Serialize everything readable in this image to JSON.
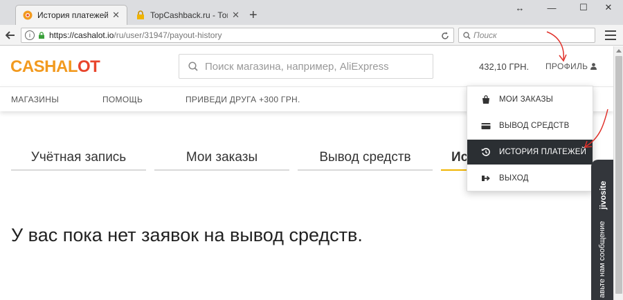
{
  "browser": {
    "tabs": [
      {
        "title": "История платежей | Cash...",
        "active": true
      },
      {
        "title": "TopCashback.ru - Топ лу...",
        "active": false
      }
    ],
    "new_tab_label": "+",
    "window_controls": {
      "resize": "↔",
      "minimize": "—",
      "maximize": "☐",
      "close": "✕"
    },
    "url": {
      "host": "https://cashalot.io",
      "path": "/ru/user/31947/payout-history"
    },
    "search_placeholder": "Поиск",
    "tab_close": "✕"
  },
  "site": {
    "logo": {
      "part1": "CASHAL",
      "part2": "OT"
    },
    "search_placeholder": "Поиск магазина, например, AliExpress",
    "balance": "432,10 ГРН.",
    "profile_label": "ПРОФИЛЬ",
    "menu": [
      "МАГАЗИНЫ",
      "ПОМОЩЬ",
      "ПРИВЕДИ ДРУГА +300 ГРН."
    ],
    "page_tabs": [
      "Учётная запись",
      "Мои заказы",
      "Вывод средств",
      "Ис"
    ],
    "empty_message": "У вас пока нет заявок на вывод средств.",
    "dropdown": [
      {
        "label": "МОИ ЗАКАЗЫ",
        "icon": "bag-icon",
        "active": false
      },
      {
        "label": "ВЫВОД СРЕДСТВ",
        "icon": "card-icon",
        "active": false
      },
      {
        "label": "ИСТОРИЯ ПЛАТЕЖЕЙ",
        "icon": "history-icon",
        "active": true
      },
      {
        "label": "ВЫХОД",
        "icon": "logout-icon",
        "active": false
      }
    ]
  },
  "jivosite": {
    "title": "jivosite",
    "subtitle": "авьте нам сообщение"
  },
  "colors": {
    "accent_orange": "#f29a1f",
    "accent_red": "#e8452c",
    "tab_active": "#f0b400",
    "menu_dark": "#2b2f33",
    "annotation": "#e0302a"
  }
}
